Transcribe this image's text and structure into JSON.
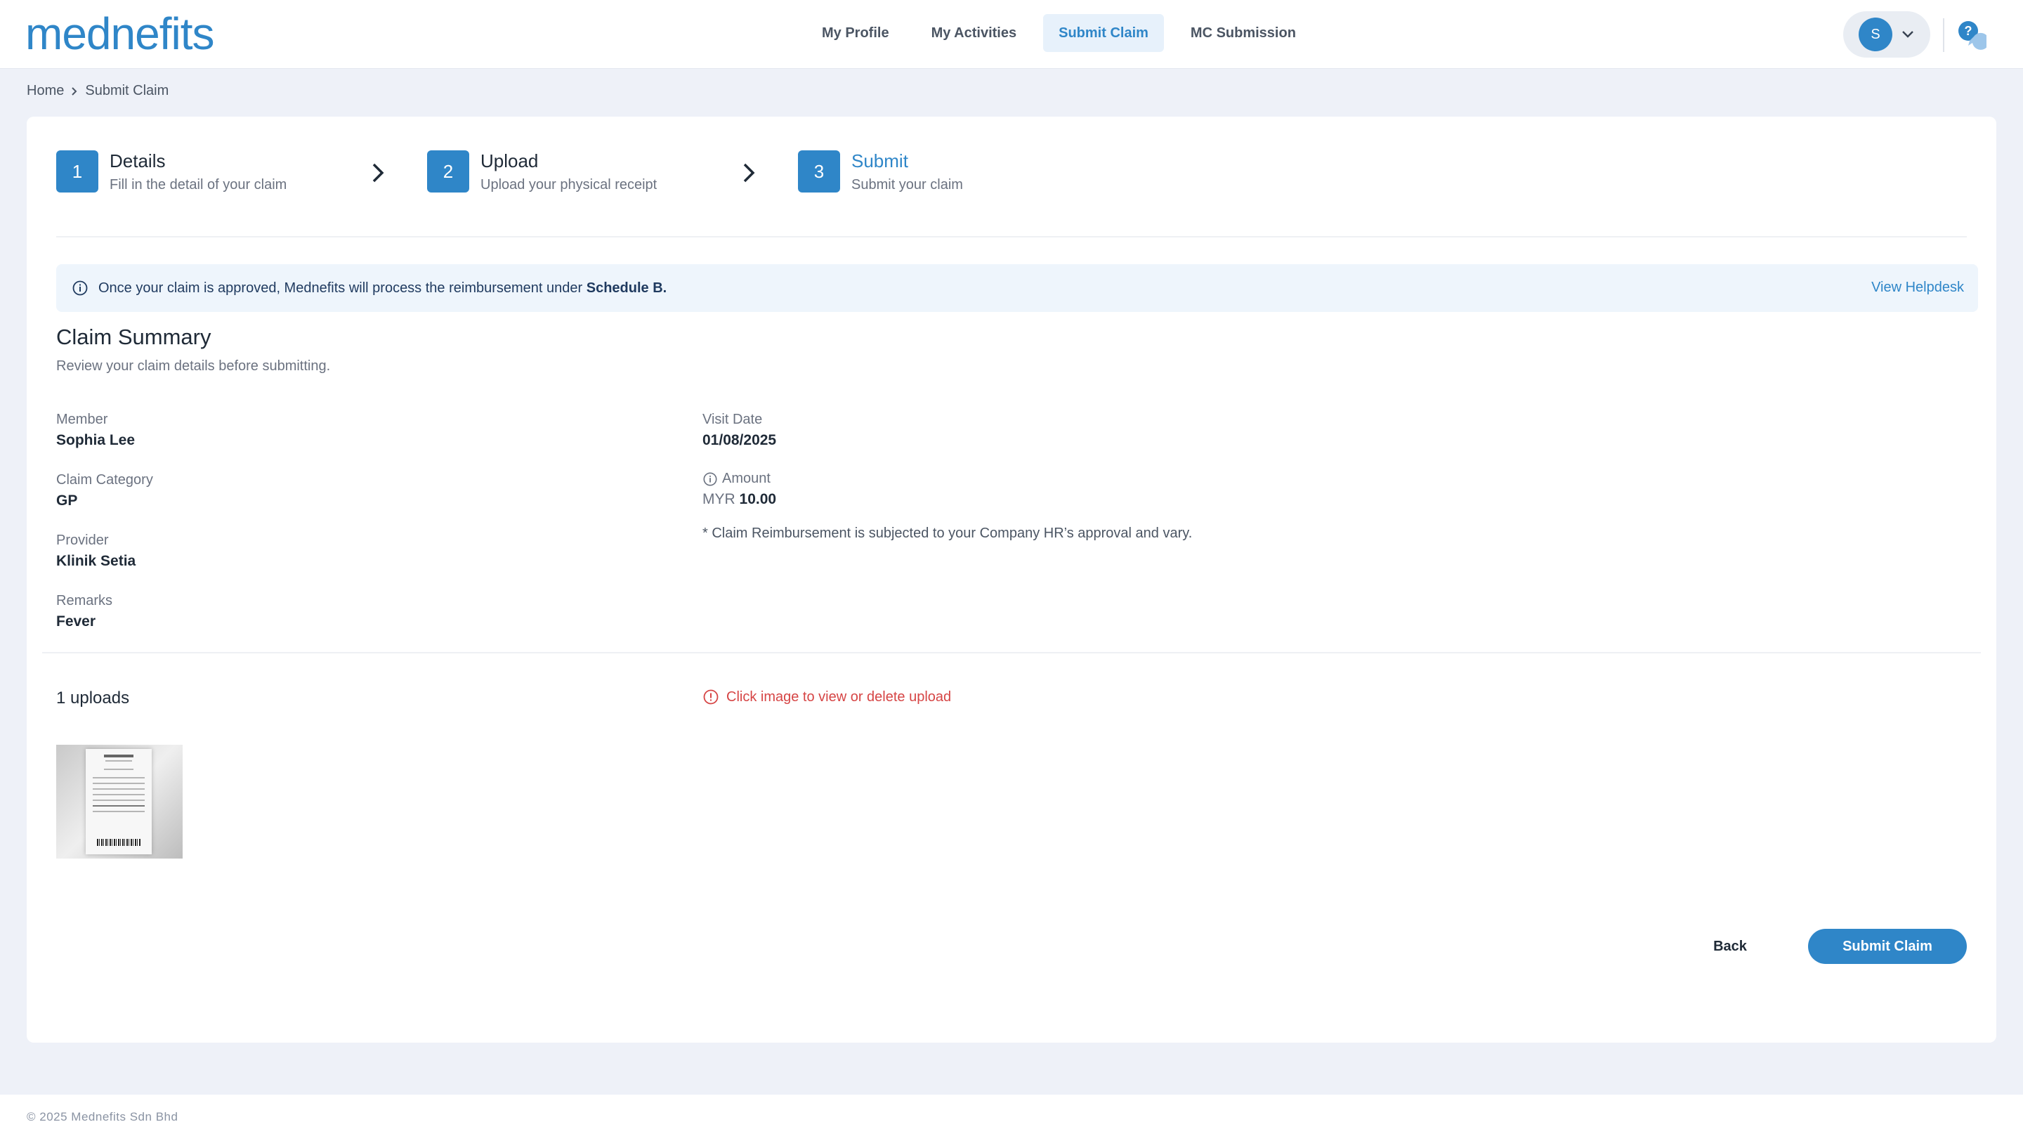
{
  "brand": {
    "logo_text": "mednefits",
    "color": "#2f86c8"
  },
  "nav": {
    "items": [
      {
        "label": "My Profile",
        "active": false
      },
      {
        "label": "My Activities",
        "active": false
      },
      {
        "label": "Submit Claim",
        "active": true
      },
      {
        "label": "MC Submission",
        "active": false
      }
    ],
    "user_initial": "S",
    "help_icon": "chat-help-icon"
  },
  "breadcrumb": {
    "home": "Home",
    "current": "Submit Claim"
  },
  "stepper": {
    "steps": [
      {
        "num": "1",
        "title": "Details",
        "sub": "Fill in the detail of your claim"
      },
      {
        "num": "2",
        "title": "Upload",
        "sub": "Upload your physical receipt"
      },
      {
        "num": "3",
        "title": "Submit",
        "sub": "Submit your claim",
        "active": true
      }
    ]
  },
  "banner": {
    "text": "Once your claim is approved, Mednefits will process the reimbursement under ",
    "bold": "Schedule B.",
    "helpdesk": "View Helpdesk"
  },
  "summary": {
    "title": "Claim Summary",
    "subtitle": "Review your claim details before submitting.",
    "member_label": "Member",
    "member": "Sophia Lee",
    "category_label": "Claim Category",
    "category": "GP",
    "provider_label": "Provider",
    "provider": "Klinik Setia",
    "remarks_label": "Remarks",
    "remarks": "Fever",
    "visit_date_label": "Visit Date",
    "visit_date": "01/08/2025",
    "amount_label": "Amount",
    "currency": "MYR",
    "amount": "10.00",
    "note": "* Claim Reimbursement is subjected to your Company HR’s approval and vary."
  },
  "uploads": {
    "count_text": "1 uploads",
    "hint": "Click image to view or delete upload"
  },
  "actions": {
    "back": "Back",
    "submit": "Submit Claim"
  },
  "footer": {
    "text": "© 2025 Mednefits Sdn Bhd"
  }
}
